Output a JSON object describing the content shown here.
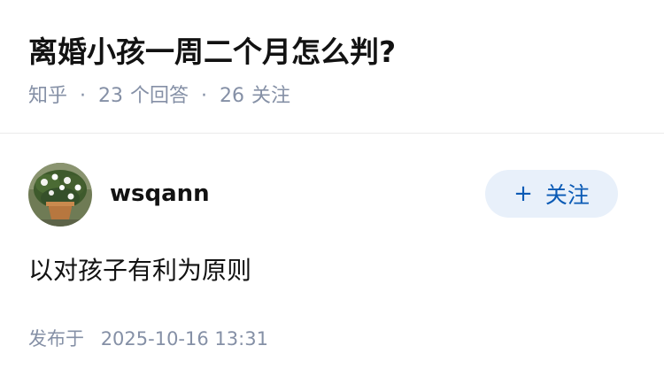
{
  "question": {
    "title": "离婚小孩一周二个月怎么判?",
    "source": "知乎",
    "answer_count": "23",
    "answer_label": "个回答",
    "follower_count": "26",
    "follower_label": "关注",
    "separator": "·"
  },
  "answer": {
    "author": {
      "name": "wsqann",
      "avatar_icon": "potted-plant-avatar-icon"
    },
    "follow_button": {
      "plus": "+",
      "label": "关注"
    },
    "content": "以对孩子有利为原则",
    "publish": {
      "label": "发布于",
      "datetime": "2025-10-16 13:31"
    }
  },
  "colors": {
    "text_primary": "#121212",
    "text_secondary": "#8590a6",
    "follow_bg": "#e8f0fa",
    "follow_text": "#0a5ab5",
    "divider": "#ebebeb"
  }
}
